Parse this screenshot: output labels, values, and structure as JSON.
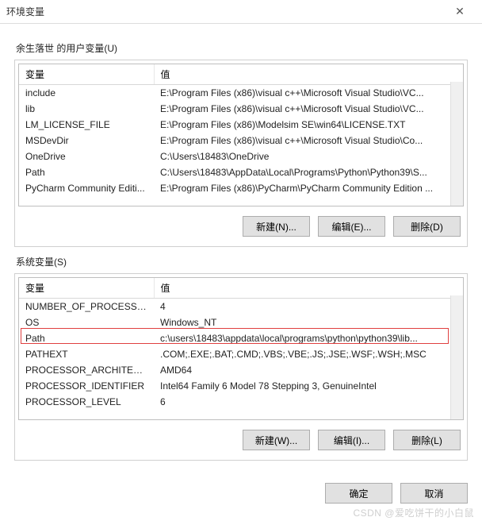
{
  "titlebar": {
    "title": "环境变量",
    "close": "✕"
  },
  "user_section": {
    "label": "余生落世 的用户变量(U)",
    "headers": {
      "name": "变量",
      "value": "值"
    },
    "rows": [
      {
        "name": "include",
        "value": "E:\\Program Files (x86)\\visual c++\\Microsoft Visual Studio\\VC..."
      },
      {
        "name": "lib",
        "value": "E:\\Program Files (x86)\\visual c++\\Microsoft Visual Studio\\VC..."
      },
      {
        "name": "LM_LICENSE_FILE",
        "value": "E:\\Program Files (x86)\\Modelsim SE\\win64\\LICENSE.TXT"
      },
      {
        "name": "MSDevDir",
        "value": "E:\\Program Files (x86)\\visual c++\\Microsoft Visual Studio\\Co..."
      },
      {
        "name": "OneDrive",
        "value": "C:\\Users\\18483\\OneDrive"
      },
      {
        "name": "Path",
        "value": "C:\\Users\\18483\\AppData\\Local\\Programs\\Python\\Python39\\S..."
      },
      {
        "name": "PyCharm Community Editi...",
        "value": "E:\\Program Files (x86)\\PyCharm\\PyCharm Community Edition ..."
      }
    ],
    "buttons": {
      "new": "新建(N)...",
      "edit": "编辑(E)...",
      "delete": "删除(D)"
    }
  },
  "system_section": {
    "label": "系统变量(S)",
    "headers": {
      "name": "变量",
      "value": "值"
    },
    "rows": [
      {
        "name": "NUMBER_OF_PROCESSORS",
        "value": "4"
      },
      {
        "name": "OS",
        "value": "Windows_NT"
      },
      {
        "name": "Path",
        "value": "c:\\users\\18483\\appdata\\local\\programs\\python\\python39\\lib...",
        "highlighted": true
      },
      {
        "name": "PATHEXT",
        "value": ".COM;.EXE;.BAT;.CMD;.VBS;.VBE;.JS;.JSE;.WSF;.WSH;.MSC"
      },
      {
        "name": "PROCESSOR_ARCHITECT...",
        "value": "AMD64"
      },
      {
        "name": "PROCESSOR_IDENTIFIER",
        "value": "Intel64 Family 6 Model 78 Stepping 3, GenuineIntel"
      },
      {
        "name": "PROCESSOR_LEVEL",
        "value": "6"
      }
    ],
    "buttons": {
      "new": "新建(W)...",
      "edit": "编辑(I)...",
      "delete": "删除(L)"
    }
  },
  "dialog_buttons": {
    "ok": "确定",
    "cancel": "取消"
  },
  "watermark": "CSDN @爱吃饼干的小白鼠"
}
